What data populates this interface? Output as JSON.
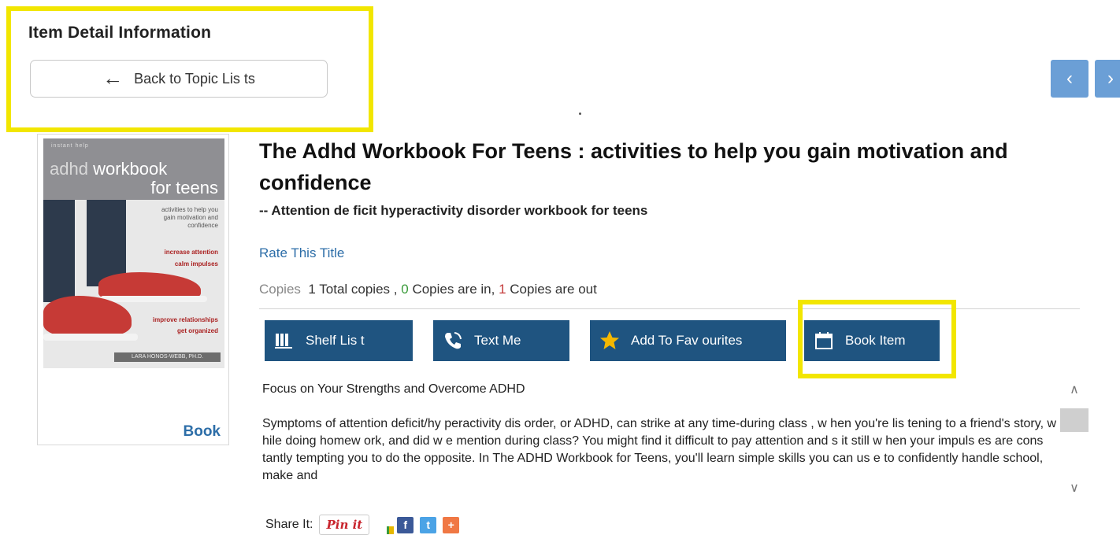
{
  "header": {
    "section_title": "Item Detail Information",
    "back_button": "Back to Topic Lis ts",
    "prev_icon": "chevron-left-icon",
    "next_icon": "chevron-right-icon"
  },
  "cover": {
    "series": "instant help",
    "title_line1_prefix": "adhd",
    "title_line1_suffix": "workbook",
    "title_line2": "for teens",
    "tagline": "activities to help you gain motivation and confidence",
    "bullet1": "increase attention",
    "bullet2": "calm impulses",
    "bullet3": "improve relationships",
    "bullet4": "get organized",
    "author": "LARA HONOS-WEBB, PH.D.",
    "format": "Book"
  },
  "item": {
    "title": "The Adhd Workbook For Teens : activities to help you gain motivation and confidence",
    "subtitle": "-- Attention de ficit hyperactivity disorder workbook for teens",
    "rate_link": "Rate This Title",
    "copies": {
      "label": "Copies",
      "total": "1",
      "total_text": "Total copies ,",
      "in": "0",
      "in_text": "Copies are in,",
      "out": "1",
      "out_text": "Copies are out"
    }
  },
  "actions": {
    "shelf_list": "Shelf Lis t",
    "text_me": "Text Me",
    "add_favourites": "Add To Fav ourites",
    "book_item": "Book Item"
  },
  "description": {
    "heading": "Focus on Your Strengths and Overcome ADHD",
    "body": "Symptoms of attention deficit/hy peractivity dis order, or ADHD, can strike at any time-during class , w hen you're lis tening to a friend's story, w hile doing homew ork, and did w e mention during class? You might find it difficult to pay attention and s it still w hen your impuls es are cons tantly tempting you to do the opposite. In The ADHD Workbook for Teens, you'll learn simple skills you can us e to confidently handle school, make and"
  },
  "share": {
    "label": "Share It:",
    "pinterest": "Pin it",
    "facebook": "f",
    "twitter": "t",
    "plus": "+"
  },
  "colors": {
    "highlight": "#f2e600",
    "action_button": "#1f5480",
    "nav_button": "#6b9fd6",
    "link": "#2d6ea8"
  }
}
